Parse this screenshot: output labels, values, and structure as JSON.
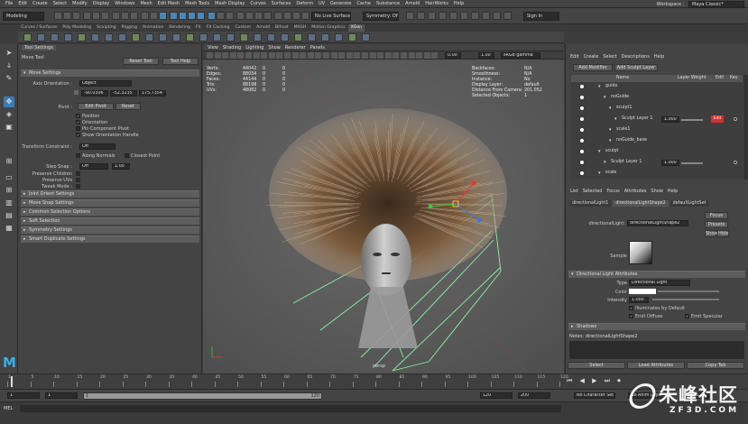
{
  "menubar": {
    "items": [
      "File",
      "Edit",
      "Create",
      "Select",
      "Modify",
      "Display",
      "Windows",
      "Mesh",
      "Edit Mesh",
      "Mesh Tools",
      "Mesh Display",
      "Curves",
      "Surfaces",
      "Deform",
      "UV",
      "Generate",
      "Cache",
      "Substance",
      "Arnold",
      "HairWorks",
      "Help"
    ],
    "workspace_label": "Workspace :",
    "workspace_value": "Maya Classic*"
  },
  "status": {
    "mode": "Modeling",
    "live_surface": "No Live Surface",
    "symmetry": "Symmetry: Off",
    "sign_in": "Sign In"
  },
  "shelf": {
    "tabs": [
      "Curves / Surfaces",
      "Poly Modeling",
      "Sculpting",
      "Rigging",
      "Animation",
      "Rendering",
      "FX",
      "FX Caching",
      "Custom",
      "Arnold",
      "Bifrost",
      "MASH",
      "Motion Graphics",
      "XGen"
    ],
    "active": 13
  },
  "toolsettings": {
    "tab": "Tool Settings",
    "tool_name": "Move Tool",
    "reset_tool": "Reset Tool",
    "tool_help": "Tool Help",
    "move_settings": "Move Settings",
    "axis_orientation_label": "Axis Orientation :",
    "axis_orientation_value": "Object",
    "coords": [
      "-90.0306",
      "-52.3235",
      "175.7354"
    ],
    "pivot_label": "Pivot :",
    "edit_pivot": "Edit Pivot",
    "reset": "Reset",
    "checks": [
      {
        "label": "Position",
        "on": true
      },
      {
        "label": "Orientation",
        "on": true
      },
      {
        "label": "Pin Component Pivot",
        "on": false
      },
      {
        "label": "Show Orientation Handle",
        "on": true
      }
    ],
    "transform_constraint_label": "Transform Constraint :",
    "transform_constraint_value": "Off",
    "along_normals": "Along Normals",
    "closest_point": "Closest Point",
    "step_snap_label": "Step Snap :",
    "step_snap_value": "Off",
    "step_snap_num": "1.00",
    "preserve_children": "Preserve Children",
    "preserve_uvs": "Preserve UVs",
    "tweak_mode": "Tweak Mode :",
    "frames": [
      "Joint Orient Settings",
      "Move Snap Settings",
      "Common Selection Options",
      "Soft Selection",
      "Symmetry Settings",
      "Smart Duplicate Settings"
    ]
  },
  "viewport": {
    "menu": [
      "View",
      "Shading",
      "Lighting",
      "Show",
      "Renderer",
      "Panels"
    ],
    "exposure": "0.00",
    "gamma": "1.00",
    "colorspace": "sRGB gamma",
    "hud_left": [
      {
        "k": "Verts:",
        "v": [
          "44042",
          "0",
          "0"
        ]
      },
      {
        "k": "Edges:",
        "v": [
          "88034",
          "0",
          "0"
        ]
      },
      {
        "k": "Faces:",
        "v": [
          "44144",
          "0",
          "0"
        ]
      },
      {
        "k": "Tris:",
        "v": [
          "88198",
          "0",
          "0"
        ]
      },
      {
        "k": "UVs:",
        "v": [
          "48082",
          "0",
          "0"
        ]
      }
    ],
    "hud_right": [
      {
        "k": "Backfaces:",
        "v": "N/A"
      },
      {
        "k": "Smoothness:",
        "v": "N/A"
      },
      {
        "k": "Instance:",
        "v": "No"
      },
      {
        "k": "Display Layer:",
        "v": "default"
      },
      {
        "k": "Distance From Camera:",
        "v": "201.052"
      },
      {
        "k": "Selected Objects:",
        "v": "1"
      }
    ],
    "camera_label": "persp"
  },
  "rightpanel": {
    "menu": [
      "Edit",
      "Create",
      "Select",
      "Descriptions",
      "Help"
    ],
    "add_modifier": "Add Modifier",
    "add_sculpt_layer": "Add Sculpt Layer",
    "columns": [
      "Name",
      "Layer Weight",
      "Edit",
      "Key"
    ],
    "rows": [
      {
        "name": "guide",
        "indent": 2
      },
      {
        "name": "noGuide",
        "indent": 3
      },
      {
        "name": "sculpt1",
        "indent": 4
      },
      {
        "name": "Sculpt Layer 1",
        "indent": 5,
        "weight": "1.000",
        "edit": "Edit"
      },
      {
        "name": "scale1",
        "indent": 4
      },
      {
        "name": "noGuide_base",
        "indent": 4
      },
      {
        "name": "sculpt",
        "indent": 2
      },
      {
        "name": "Sculpt Layer 1",
        "indent": 3,
        "weight": "1.000"
      },
      {
        "name": "scale",
        "indent": 2
      }
    ],
    "attr_tabs": [
      "List",
      "Selected",
      "Focus",
      "Attributes",
      "Show",
      "Help"
    ],
    "node_tabs": [
      "directionalLight1",
      "directionalLightShape2",
      "defaultLightSet"
    ],
    "node_label": "directionalLight:",
    "node_value": "directionalLightShape2",
    "focus": "Focus",
    "presets": "Presets",
    "show": "Show",
    "hide": "Hide",
    "sample": "Sample",
    "section": "Directional Light Attributes",
    "type_label": "Type",
    "type_value": "Directional Light",
    "color_label": "Color",
    "intensity_label": "Intensity",
    "intensity_value": "1.000",
    "illum_default": "Illuminates by Default",
    "emit_diffuse": "Emit Diffuse",
    "emit_specular": "Emit Specular",
    "shadows": "Shadows",
    "notes": "Notes: directionalLightShape2",
    "bottom_buttons": [
      "Select",
      "Load Attributes",
      "Copy Tab"
    ]
  },
  "timeslider": {
    "ticks": [
      "1",
      "5",
      "10",
      "15",
      "20",
      "25",
      "30",
      "35",
      "40",
      "45",
      "50",
      "55",
      "60",
      "65",
      "70",
      "75",
      "80",
      "85",
      "90",
      "95",
      "100",
      "105",
      "110",
      "115",
      "120"
    ]
  },
  "rangeslider": {
    "start": "1",
    "start2": "1",
    "slider_start": "1",
    "slider_end": "120",
    "end": "120",
    "end2": "200",
    "char_set": "No Character Set",
    "anim_layer": "No Anim Layer",
    "fps": "24 fps"
  },
  "cmdline": {
    "label": "MEL"
  },
  "watermark": {
    "cn": "朱峰社区",
    "en": "ZF3D.COM"
  },
  "colors": {
    "accent": "#3d7bb4",
    "edit_red": "#d43030",
    "bg": "#444444"
  }
}
